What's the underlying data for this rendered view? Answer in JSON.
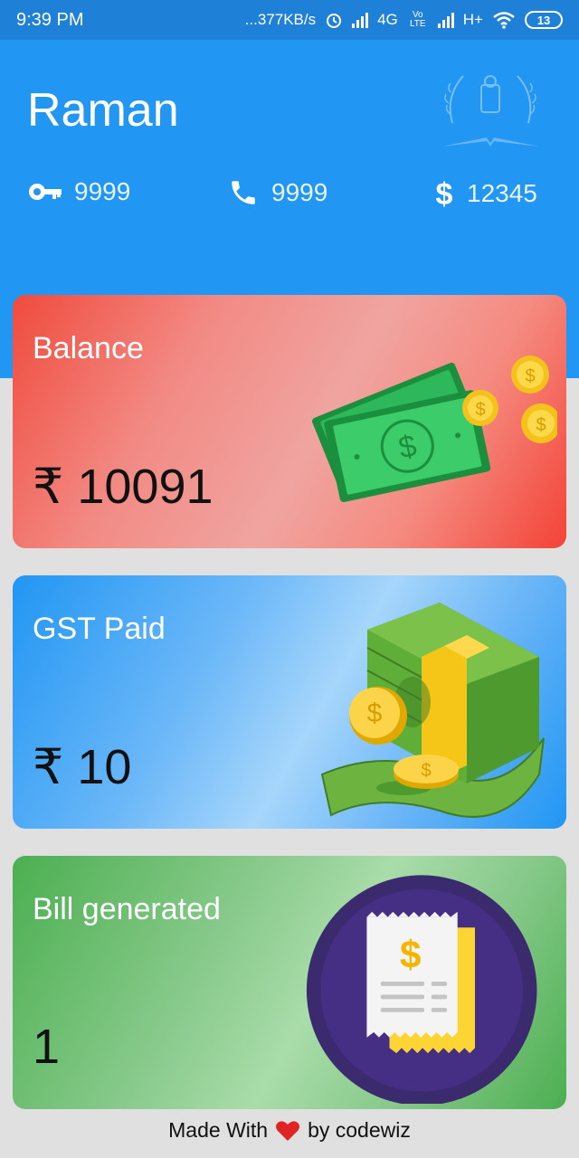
{
  "status_bar": {
    "time": "9:39 PM",
    "net_speed": "...377KB/s",
    "network_1": "4G",
    "volte": "Vo LTE",
    "network_2": "H+",
    "battery": "13"
  },
  "header": {
    "user_name": "Raman",
    "stats": [
      {
        "icon": "key-icon",
        "value": "9999"
      },
      {
        "icon": "phone-icon",
        "value": "9999"
      },
      {
        "icon": "dollar-icon",
        "value": "12345"
      }
    ]
  },
  "cards": {
    "balance": {
      "title": "Balance",
      "value": "₹ 10091",
      "color": "#f44336"
    },
    "gst": {
      "title": "GST Paid",
      "value": "₹ 10",
      "color": "#2196f3"
    },
    "bill": {
      "title": "Bill generated",
      "value": "1",
      "color": "#4caf50"
    }
  },
  "footer": {
    "made_with": "Made With",
    "by": "by codewiz"
  },
  "colors": {
    "header_bg": "#2196f3",
    "status_bar_bg": "#1e80d6",
    "page_bg": "#e0e0e0"
  }
}
